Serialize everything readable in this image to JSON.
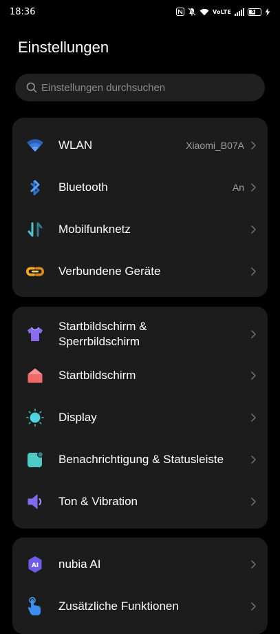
{
  "status_bar": {
    "time": "18:36",
    "volte": "VoLTE",
    "battery": "51"
  },
  "header": {
    "title": "Einstellungen"
  },
  "search": {
    "placeholder": "Einstellungen durchsuchen"
  },
  "groups": [
    {
      "items": [
        {
          "label": "WLAN",
          "value": "Xiaomi_B07A",
          "icon": "wifi-icon"
        },
        {
          "label": "Bluetooth",
          "value": "An",
          "icon": "bluetooth-icon"
        },
        {
          "label": "Mobilfunknetz",
          "icon": "mobile-data-icon"
        },
        {
          "label": "Verbundene Geräte",
          "icon": "link-icon"
        }
      ]
    },
    {
      "items": [
        {
          "label": "Startbildschirm &",
          "label_line2": "Sperrbildschirm",
          "icon": "shirt-icon"
        },
        {
          "label": "Startbildschirm",
          "icon": "home-icon"
        },
        {
          "label": "Display",
          "icon": "sun-icon"
        },
        {
          "label": "Benachrichtigung & Statusleiste",
          "icon": "notification-icon"
        },
        {
          "label": "Ton & Vibration",
          "icon": "speaker-icon"
        }
      ]
    },
    {
      "items": [
        {
          "label": "nubia AI",
          "icon": "ai-icon",
          "icon_text": "AI"
        },
        {
          "label": "Zusätzliche Funktionen",
          "icon": "hand-pointer-icon"
        }
      ]
    }
  ],
  "colors": {
    "background": "#000000",
    "card": "#1c1c1c",
    "wifi_blue": "#3a7de0",
    "bluetooth_blue": "#3b8ef0",
    "mobile_teal": "#4fc3c8",
    "link_orange": "#f5a623",
    "shirt_purple": "#8a6cf0",
    "home_red": "#ef6a6a",
    "sun_cyan": "#4dd4e0",
    "notif_teal": "#4ec9c4",
    "speaker_purple": "#7f6cf0",
    "ai_purple": "#6c5ce7",
    "hand_blue": "#3b8ef0"
  }
}
